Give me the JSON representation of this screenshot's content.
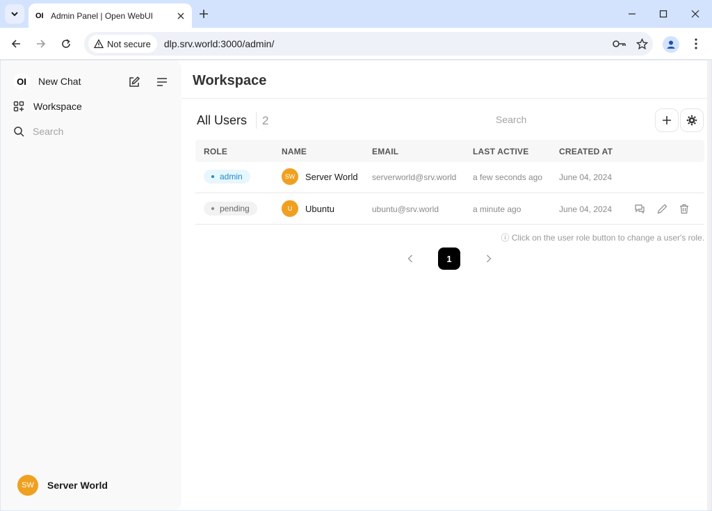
{
  "browser": {
    "tab_title": "Admin Panel | Open WebUI",
    "tab_favicon": "OI",
    "security_label": "Not secure",
    "url": "dlp.srv.world:3000/admin/"
  },
  "sidebar": {
    "logo": "OI",
    "new_chat": "New Chat",
    "workspace": "Workspace",
    "search_placeholder": "Search",
    "user": {
      "initials": "SW",
      "name": "Server World"
    }
  },
  "main": {
    "title": "Workspace",
    "section_title": "All Users",
    "user_count": "2",
    "search_placeholder": "Search",
    "columns": [
      "ROLE",
      "NAME",
      "EMAIL",
      "LAST ACTIVE",
      "CREATED AT"
    ],
    "rows": [
      {
        "role": "admin",
        "initials": "SW",
        "name": "Server World",
        "email": "serverworld@srv.world",
        "last_active": "a few seconds ago",
        "created_at": "June 04, 2024"
      },
      {
        "role": "pending",
        "initials": "U",
        "name": "Ubuntu",
        "email": "ubuntu@srv.world",
        "last_active": "a minute ago",
        "created_at": "June 04, 2024"
      }
    ],
    "note": "ⓘ Click on the user role button to change a user's role.",
    "current_page": "1"
  },
  "colors": {
    "avatar": "#f0a020",
    "admin_badge": "#1a8cc7",
    "tab_strip": "#d3e3fd"
  }
}
